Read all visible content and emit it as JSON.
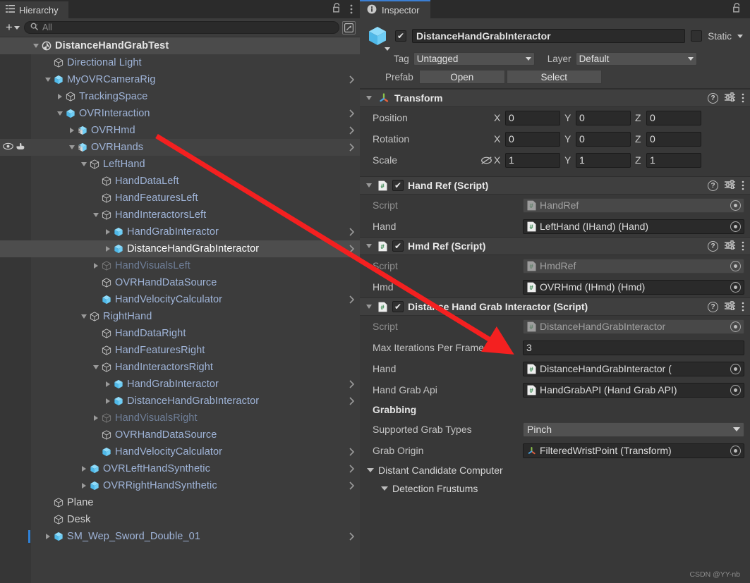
{
  "hierarchy": {
    "tab_label": "Hierarchy",
    "toolbar": {
      "add_label": "+",
      "search_placeholder": "All"
    },
    "rows": [
      {
        "label": "DistanceHandGrabTest",
        "depth": 0,
        "fold": "down",
        "icon": "unity-scene-icon",
        "kind": "scene",
        "chev": false
      },
      {
        "label": "Directional Light",
        "depth": 1,
        "fold": "none",
        "icon": "gameobject-icon",
        "kind": "normal",
        "chev": false
      },
      {
        "label": "MyOVRCameraRig",
        "depth": 1,
        "fold": "down",
        "icon": "prefab-icon",
        "kind": "normal",
        "chev": true
      },
      {
        "label": "TrackingSpace",
        "depth": 2,
        "fold": "right",
        "icon": "gameobject-icon",
        "kind": "normal",
        "chev": false
      },
      {
        "label": "OVRInteraction",
        "depth": 2,
        "fold": "down",
        "icon": "prefab-icon",
        "kind": "normal",
        "chev": true
      },
      {
        "label": "OVRHmd",
        "depth": 3,
        "fold": "right",
        "icon": "prefab-variant-icon",
        "kind": "normal",
        "chev": true
      },
      {
        "label": "OVRHands",
        "depth": 3,
        "fold": "down",
        "icon": "prefab-variant-icon",
        "kind": "hover",
        "chev": true,
        "eye": true
      },
      {
        "label": "LeftHand",
        "depth": 4,
        "fold": "down",
        "icon": "gameobject-icon",
        "kind": "normal",
        "chev": false
      },
      {
        "label": "HandDataLeft",
        "depth": 5,
        "fold": "none",
        "icon": "gameobject-icon",
        "kind": "normal",
        "chev": false
      },
      {
        "label": "HandFeaturesLeft",
        "depth": 5,
        "fold": "none",
        "icon": "gameobject-icon",
        "kind": "normal",
        "chev": false
      },
      {
        "label": "HandInteractorsLeft",
        "depth": 5,
        "fold": "down",
        "icon": "gameobject-icon",
        "kind": "normal",
        "chev": false
      },
      {
        "label": "HandGrabInteractor",
        "depth": 6,
        "fold": "right",
        "icon": "prefab-icon",
        "kind": "normal",
        "chev": true
      },
      {
        "label": "DistanceHandGrabInteractor",
        "depth": 6,
        "fold": "right",
        "icon": "prefab-icon",
        "kind": "selected",
        "chev": true
      },
      {
        "label": "HandVisualsLeft",
        "depth": 5,
        "fold": "right",
        "icon": "gameobject-icon",
        "kind": "disabled",
        "chev": false
      },
      {
        "label": "OVRHandDataSource",
        "depth": 5,
        "fold": "none",
        "icon": "gameobject-icon",
        "kind": "normal",
        "chev": false
      },
      {
        "label": "HandVelocityCalculator",
        "depth": 5,
        "fold": "none",
        "icon": "prefab-icon",
        "kind": "normal",
        "chev": true
      },
      {
        "label": "RightHand",
        "depth": 4,
        "fold": "down",
        "icon": "gameobject-icon",
        "kind": "normal",
        "chev": false
      },
      {
        "label": "HandDataRight",
        "depth": 5,
        "fold": "none",
        "icon": "gameobject-icon",
        "kind": "normal",
        "chev": false
      },
      {
        "label": "HandFeaturesRight",
        "depth": 5,
        "fold": "none",
        "icon": "gameobject-icon",
        "kind": "normal",
        "chev": false
      },
      {
        "label": "HandInteractorsRight",
        "depth": 5,
        "fold": "down",
        "icon": "gameobject-icon",
        "kind": "normal",
        "chev": false
      },
      {
        "label": "HandGrabInteractor",
        "depth": 6,
        "fold": "right",
        "icon": "prefab-icon",
        "kind": "normal",
        "chev": true
      },
      {
        "label": "DistanceHandGrabInteractor",
        "depth": 6,
        "fold": "right",
        "icon": "prefab-icon",
        "kind": "normal",
        "chev": true
      },
      {
        "label": "HandVisualsRight",
        "depth": 5,
        "fold": "right",
        "icon": "gameobject-icon",
        "kind": "disabled",
        "chev": false
      },
      {
        "label": "OVRHandDataSource",
        "depth": 5,
        "fold": "none",
        "icon": "gameobject-icon",
        "kind": "normal",
        "chev": false
      },
      {
        "label": "HandVelocityCalculator",
        "depth": 5,
        "fold": "none",
        "icon": "prefab-icon",
        "kind": "normal",
        "chev": true
      },
      {
        "label": "OVRLeftHandSynthetic",
        "depth": 4,
        "fold": "right",
        "icon": "prefab-icon",
        "kind": "normal",
        "chev": true
      },
      {
        "label": "OVRRightHandSynthetic",
        "depth": 4,
        "fold": "right",
        "icon": "prefab-icon",
        "kind": "normal",
        "chev": true
      },
      {
        "label": "Plane",
        "depth": 1,
        "fold": "none",
        "icon": "gameobject-icon",
        "kind": "white",
        "chev": false
      },
      {
        "label": "Desk",
        "depth": 1,
        "fold": "none",
        "icon": "gameobject-icon",
        "kind": "white",
        "chev": false
      },
      {
        "label": "SM_Wep_Sword_Double_01",
        "depth": 1,
        "fold": "right",
        "icon": "prefab-icon",
        "kind": "normal",
        "chev": true,
        "marker": true
      }
    ]
  },
  "inspector": {
    "tab_label": "Inspector",
    "gameobject": {
      "enabled": true,
      "name": "DistanceHandGrabInteractor",
      "static_label": "Static",
      "static_checked": false,
      "tag_label": "Tag",
      "tag_value": "Untagged",
      "layer_label": "Layer",
      "layer_value": "Default",
      "prefab_label": "Prefab",
      "prefab_open": "Open",
      "prefab_select": "Select"
    },
    "components": [
      {
        "name": "transform",
        "title": "Transform",
        "has_checkbox": false,
        "icon": "transform-axis-icon",
        "vector_rows": [
          {
            "label": "Position",
            "x": "0",
            "y": "0",
            "z": "0",
            "eye_off": false
          },
          {
            "label": "Rotation",
            "x": "0",
            "y": "0",
            "z": "0",
            "eye_off": false
          },
          {
            "label": "Scale",
            "x": "1",
            "y": "1",
            "z": "1",
            "eye_off": true
          }
        ]
      },
      {
        "name": "hand-ref",
        "title": "Hand Ref (Script)",
        "has_checkbox": true,
        "checked": true,
        "icon": "cs-script-icon",
        "fields": [
          {
            "label": "Script",
            "value": "HandRef",
            "disabled": true,
            "icon": "cs-script-icon"
          },
          {
            "label": "Hand",
            "value": "LeftHand (IHand) (Hand)",
            "disabled": false,
            "icon": "cs-script-icon"
          }
        ]
      },
      {
        "name": "hmd-ref",
        "title": "Hmd Ref (Script)",
        "has_checkbox": true,
        "checked": true,
        "icon": "cs-script-icon",
        "fields": [
          {
            "label": "Script",
            "value": "HmdRef",
            "disabled": true,
            "icon": "cs-script-icon"
          },
          {
            "label": "Hmd",
            "value": "OVRHmd (IHmd) (Hmd)",
            "disabled": false,
            "icon": "cs-script-icon"
          }
        ]
      },
      {
        "name": "distance-hand-grab-interactor",
        "title": "Distance Hand Grab Interactor (Script)",
        "has_checkbox": true,
        "checked": true,
        "icon": "cs-script-icon",
        "fields": [
          {
            "label": "Script",
            "value": "DistanceHandGrabInteractor",
            "disabled": true,
            "icon": "cs-script-icon"
          },
          {
            "label": "Max Iterations Per Frame",
            "value": "3",
            "type": "number"
          },
          {
            "label": "Hand",
            "value": "DistanceHandGrabInteractor (",
            "disabled": false,
            "icon": "cs-script-icon"
          },
          {
            "label": "Hand Grab Api",
            "value": "HandGrabAPI (Hand Grab API)",
            "disabled": false,
            "icon": "cs-script-icon"
          }
        ],
        "section_title": "Grabbing",
        "section_fields": [
          {
            "label": "Supported Grab Types",
            "value": "Pinch",
            "type": "dropdown"
          },
          {
            "label": "Grab Origin",
            "value": "FilteredWristPoint (Transform)",
            "type": "object",
            "icon": "transform-axis-icon"
          }
        ],
        "foldouts": [
          {
            "label": "Distant Candidate Computer",
            "depth": 0
          },
          {
            "label": "Detection Frustums",
            "depth": 1
          }
        ]
      }
    ]
  },
  "watermark": "CSDN @YY-nb",
  "colors": {
    "accent": "#3b7fd4",
    "prefab_blue": "#4fc3f7",
    "label_blue": "#8ca9d8",
    "arrow_red": "#f42020"
  }
}
